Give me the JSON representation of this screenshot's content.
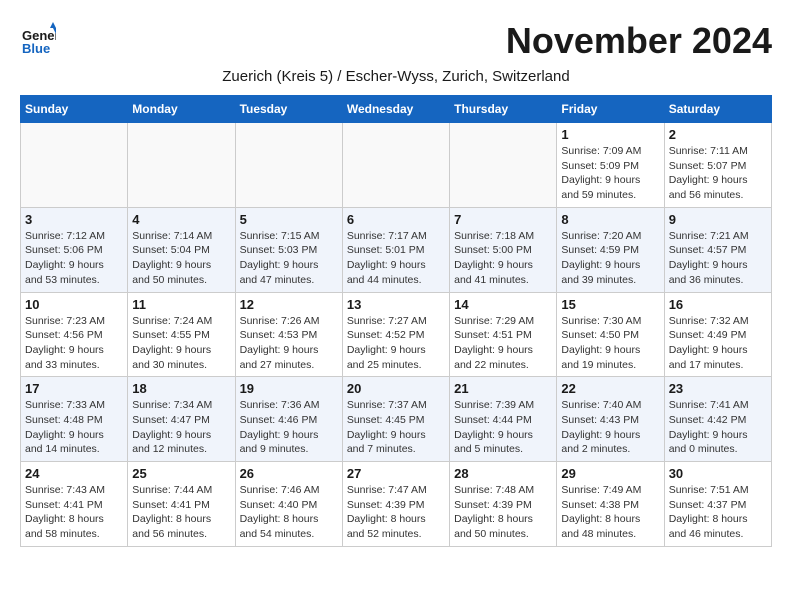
{
  "header": {
    "logo_line1": "General",
    "logo_line2": "Blue",
    "month_title": "November 2024",
    "subtitle": "Zuerich (Kreis 5) / Escher-Wyss, Zurich, Switzerland"
  },
  "weekdays": [
    "Sunday",
    "Monday",
    "Tuesday",
    "Wednesday",
    "Thursday",
    "Friday",
    "Saturday"
  ],
  "weeks": [
    [
      {
        "day": "",
        "info": ""
      },
      {
        "day": "",
        "info": ""
      },
      {
        "day": "",
        "info": ""
      },
      {
        "day": "",
        "info": ""
      },
      {
        "day": "",
        "info": ""
      },
      {
        "day": "1",
        "info": "Sunrise: 7:09 AM\nSunset: 5:09 PM\nDaylight: 9 hours and 59 minutes."
      },
      {
        "day": "2",
        "info": "Sunrise: 7:11 AM\nSunset: 5:07 PM\nDaylight: 9 hours and 56 minutes."
      }
    ],
    [
      {
        "day": "3",
        "info": "Sunrise: 7:12 AM\nSunset: 5:06 PM\nDaylight: 9 hours and 53 minutes."
      },
      {
        "day": "4",
        "info": "Sunrise: 7:14 AM\nSunset: 5:04 PM\nDaylight: 9 hours and 50 minutes."
      },
      {
        "day": "5",
        "info": "Sunrise: 7:15 AM\nSunset: 5:03 PM\nDaylight: 9 hours and 47 minutes."
      },
      {
        "day": "6",
        "info": "Sunrise: 7:17 AM\nSunset: 5:01 PM\nDaylight: 9 hours and 44 minutes."
      },
      {
        "day": "7",
        "info": "Sunrise: 7:18 AM\nSunset: 5:00 PM\nDaylight: 9 hours and 41 minutes."
      },
      {
        "day": "8",
        "info": "Sunrise: 7:20 AM\nSunset: 4:59 PM\nDaylight: 9 hours and 39 minutes."
      },
      {
        "day": "9",
        "info": "Sunrise: 7:21 AM\nSunset: 4:57 PM\nDaylight: 9 hours and 36 minutes."
      }
    ],
    [
      {
        "day": "10",
        "info": "Sunrise: 7:23 AM\nSunset: 4:56 PM\nDaylight: 9 hours and 33 minutes."
      },
      {
        "day": "11",
        "info": "Sunrise: 7:24 AM\nSunset: 4:55 PM\nDaylight: 9 hours and 30 minutes."
      },
      {
        "day": "12",
        "info": "Sunrise: 7:26 AM\nSunset: 4:53 PM\nDaylight: 9 hours and 27 minutes."
      },
      {
        "day": "13",
        "info": "Sunrise: 7:27 AM\nSunset: 4:52 PM\nDaylight: 9 hours and 25 minutes."
      },
      {
        "day": "14",
        "info": "Sunrise: 7:29 AM\nSunset: 4:51 PM\nDaylight: 9 hours and 22 minutes."
      },
      {
        "day": "15",
        "info": "Sunrise: 7:30 AM\nSunset: 4:50 PM\nDaylight: 9 hours and 19 minutes."
      },
      {
        "day": "16",
        "info": "Sunrise: 7:32 AM\nSunset: 4:49 PM\nDaylight: 9 hours and 17 minutes."
      }
    ],
    [
      {
        "day": "17",
        "info": "Sunrise: 7:33 AM\nSunset: 4:48 PM\nDaylight: 9 hours and 14 minutes."
      },
      {
        "day": "18",
        "info": "Sunrise: 7:34 AM\nSunset: 4:47 PM\nDaylight: 9 hours and 12 minutes."
      },
      {
        "day": "19",
        "info": "Sunrise: 7:36 AM\nSunset: 4:46 PM\nDaylight: 9 hours and 9 minutes."
      },
      {
        "day": "20",
        "info": "Sunrise: 7:37 AM\nSunset: 4:45 PM\nDaylight: 9 hours and 7 minutes."
      },
      {
        "day": "21",
        "info": "Sunrise: 7:39 AM\nSunset: 4:44 PM\nDaylight: 9 hours and 5 minutes."
      },
      {
        "day": "22",
        "info": "Sunrise: 7:40 AM\nSunset: 4:43 PM\nDaylight: 9 hours and 2 minutes."
      },
      {
        "day": "23",
        "info": "Sunrise: 7:41 AM\nSunset: 4:42 PM\nDaylight: 9 hours and 0 minutes."
      }
    ],
    [
      {
        "day": "24",
        "info": "Sunrise: 7:43 AM\nSunset: 4:41 PM\nDaylight: 8 hours and 58 minutes."
      },
      {
        "day": "25",
        "info": "Sunrise: 7:44 AM\nSunset: 4:41 PM\nDaylight: 8 hours and 56 minutes."
      },
      {
        "day": "26",
        "info": "Sunrise: 7:46 AM\nSunset: 4:40 PM\nDaylight: 8 hours and 54 minutes."
      },
      {
        "day": "27",
        "info": "Sunrise: 7:47 AM\nSunset: 4:39 PM\nDaylight: 8 hours and 52 minutes."
      },
      {
        "day": "28",
        "info": "Sunrise: 7:48 AM\nSunset: 4:39 PM\nDaylight: 8 hours and 50 minutes."
      },
      {
        "day": "29",
        "info": "Sunrise: 7:49 AM\nSunset: 4:38 PM\nDaylight: 8 hours and 48 minutes."
      },
      {
        "day": "30",
        "info": "Sunrise: 7:51 AM\nSunset: 4:37 PM\nDaylight: 8 hours and 46 minutes."
      }
    ]
  ],
  "accent_color": "#1565c0"
}
